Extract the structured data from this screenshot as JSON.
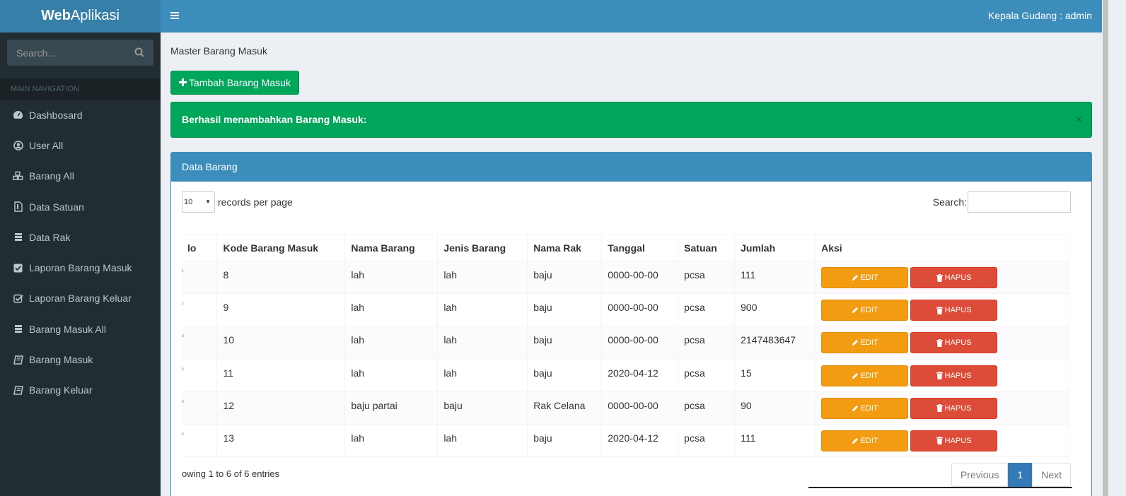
{
  "app": {
    "logo_bold": "Web",
    "logo_rest": "Aplikasi",
    "user": "Kepala Gudang : admin"
  },
  "sidebar": {
    "search_placeholder": "Search...",
    "header": "MAIN NAVIGATION",
    "items": [
      {
        "label": "Dashbosard",
        "icon": "dashboard-icon"
      },
      {
        "label": "User All",
        "icon": "user-circle-icon"
      },
      {
        "label": "Barang All",
        "icon": "cubes-icon"
      },
      {
        "label": "Data Satuan",
        "icon": "file-icon"
      },
      {
        "label": "Data Rak",
        "icon": "list-icon"
      },
      {
        "label": "Laporan Barang Masuk",
        "icon": "check-square-icon"
      },
      {
        "label": "Laporan Barang Keluar",
        "icon": "check-square-o-icon"
      },
      {
        "label": "Barang Masuk All",
        "icon": "list-icon"
      },
      {
        "label": "Barang Masuk",
        "icon": "book-icon"
      },
      {
        "label": "Barang Keluar",
        "icon": "book-icon"
      }
    ]
  },
  "main": {
    "page_title": "Master Barang Masuk",
    "add_button": "Tambah Barang Masuk",
    "alert": "Berhasil menambahkan Barang Masuk:",
    "alert_close": "×",
    "box_title": "Data Barang",
    "length_value": "10",
    "length_suffix": "records per page",
    "search_label": "Search:",
    "columns": [
      "lo",
      "Kode Barang Masuk",
      "Nama Barang",
      "Jenis Barang",
      "Nama Rak",
      "Tanggal",
      "Satuan",
      "Jumlah",
      "Aksi"
    ],
    "rows": [
      {
        "no": "1",
        "kode": "8",
        "nama": "lah",
        "jenis": "lah",
        "rak": "baju",
        "tanggal": "0000-00-00",
        "satuan": "pcsa",
        "jumlah": "111"
      },
      {
        "no": "2",
        "kode": "9",
        "nama": "lah",
        "jenis": "lah",
        "rak": "baju",
        "tanggal": "0000-00-00",
        "satuan": "pcsa",
        "jumlah": "900"
      },
      {
        "no": "3",
        "kode": "10",
        "nama": "lah",
        "jenis": "lah",
        "rak": "baju",
        "tanggal": "0000-00-00",
        "satuan": "pcsa",
        "jumlah": "2147483647"
      },
      {
        "no": "4",
        "kode": "11",
        "nama": "lah",
        "jenis": "lah",
        "rak": "baju",
        "tanggal": "2020-04-12",
        "satuan": "pcsa",
        "jumlah": "15"
      },
      {
        "no": "5",
        "kode": "12",
        "nama": "baju partai",
        "jenis": "baju",
        "rak": "Rak Celana",
        "tanggal": "0000-00-00",
        "satuan": "pcsa",
        "jumlah": "90"
      },
      {
        "no": "6",
        "kode": "13",
        "nama": "lah",
        "jenis": "lah",
        "rak": "baju",
        "tanggal": "2020-04-12",
        "satuan": "pcsa",
        "jumlah": "111"
      }
    ],
    "edit_label": "EDIT",
    "delete_label": "HAPUS",
    "info": "owing 1 to 6 of 6 entries",
    "pager": {
      "prev": "Previous",
      "current": "1",
      "next": "Next"
    }
  }
}
